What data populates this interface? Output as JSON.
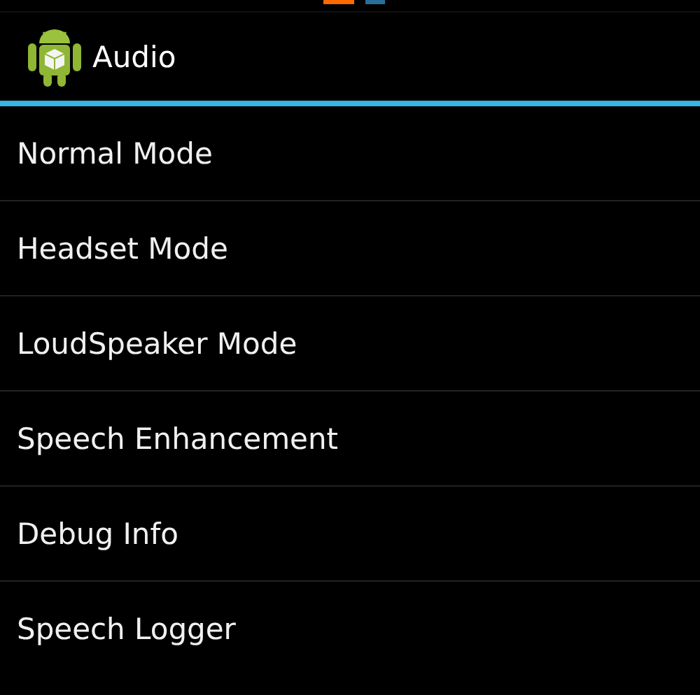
{
  "action_bar": {
    "title": "Audio"
  },
  "menu_items": [
    {
      "label": "Normal Mode"
    },
    {
      "label": "Headset Mode"
    },
    {
      "label": "LoudSpeaker Mode"
    },
    {
      "label": "Speech Enhancement"
    },
    {
      "label": "Debug Info"
    },
    {
      "label": "Speech Logger"
    }
  ]
}
